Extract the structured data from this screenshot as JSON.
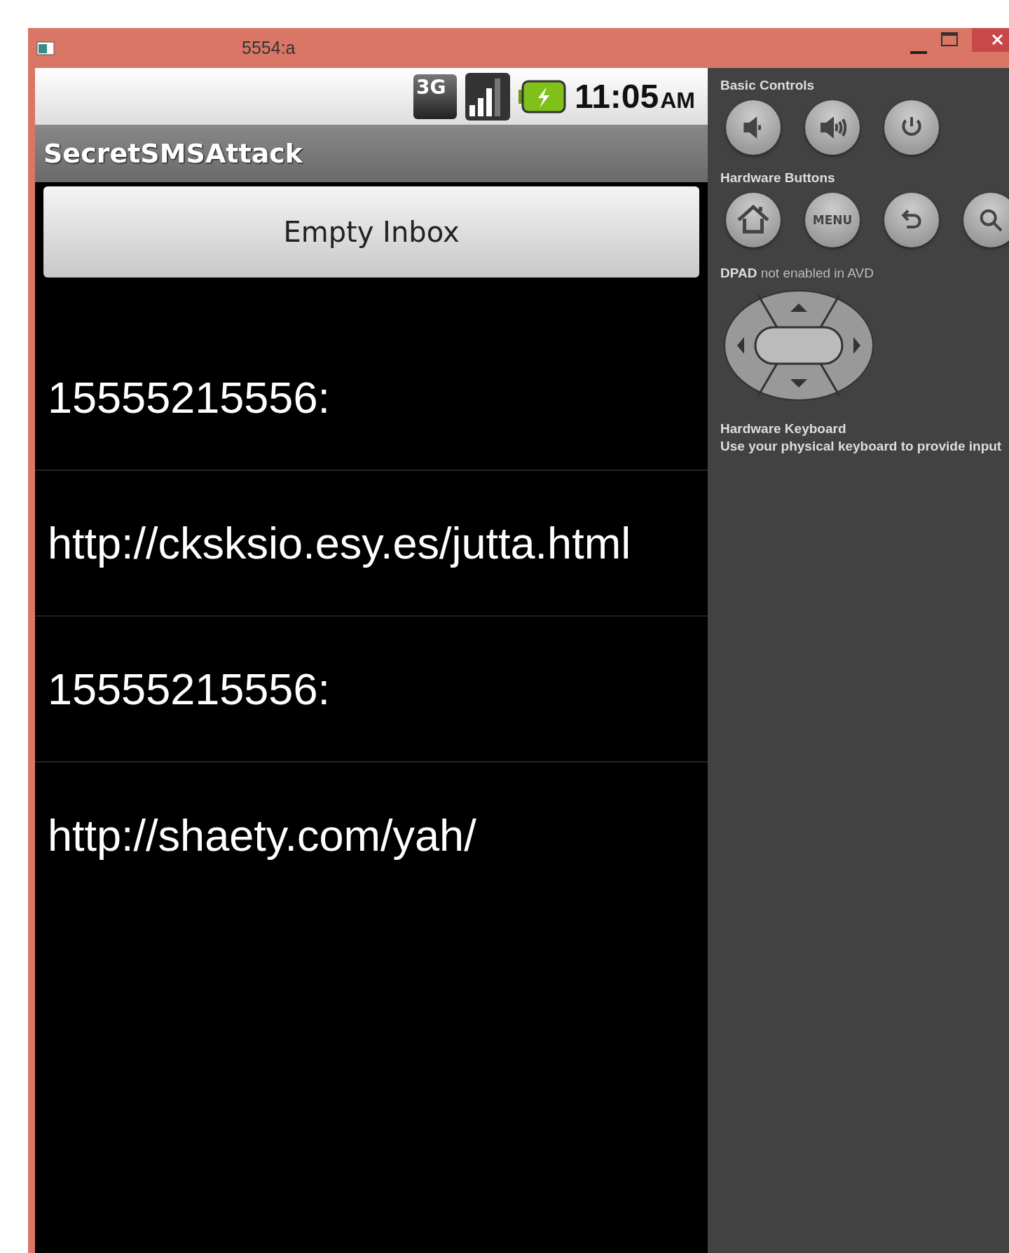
{
  "window": {
    "title": "5554:a"
  },
  "status_bar": {
    "network_type": "3G",
    "time": "11:05",
    "meridiem": "AM"
  },
  "app": {
    "title": "SecretSMSAttack",
    "button": "Empty Inbox",
    "messages": [
      "15555215556:",
      "http://cksksio.esy.es/jutta.html",
      "15555215556:",
      "http://shaety.com/yah/"
    ]
  },
  "controls": {
    "basic_label": "Basic Controls",
    "basic_buttons": [
      {
        "kind": "volume-down"
      },
      {
        "kind": "volume-up"
      },
      {
        "kind": "power"
      }
    ],
    "hardware_label": "Hardware Buttons",
    "hardware_buttons": [
      {
        "kind": "home"
      },
      {
        "kind": "menu",
        "label": "MENU"
      },
      {
        "kind": "back"
      },
      {
        "kind": "search"
      }
    ],
    "dpad_label": "**DPAD** not enabled in AVD",
    "keyboard_title": "Hardware Keyboard",
    "keyboard_hint": "Use your physical keyboard to provide input"
  }
}
